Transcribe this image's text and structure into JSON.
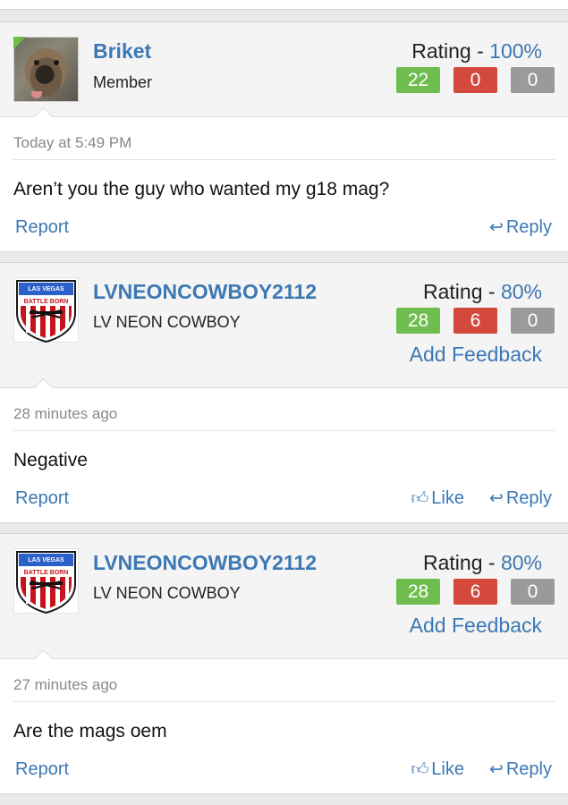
{
  "posts": [
    {
      "username": "Briket",
      "user_title": "Member",
      "rating_label": "Rating - ",
      "rating_value": "100%",
      "feedback_positive": "22",
      "feedback_negative": "0",
      "feedback_neutral": "0",
      "timestamp": "Today at 5:49 PM",
      "message": "Aren’t you the guy who wanted my g18 mag?",
      "report_label": "Report",
      "reply_label": "Reply",
      "online_indicator_color": "#6fbd43"
    },
    {
      "username": "LVNEONCOWBOY2112",
      "user_title": "LV NEON COWBOY",
      "rating_label": "Rating - ",
      "rating_value": "80%",
      "feedback_positive": "28",
      "feedback_negative": "6",
      "feedback_neutral": "0",
      "add_feedback_label": "Add Feedback",
      "timestamp": "28 minutes ago",
      "message": "Negative",
      "report_label": "Report",
      "like_label": "Like",
      "reply_label": "Reply",
      "avatar_text_top": "LAS VEGAS",
      "avatar_text_banner": "BATTLE BORN"
    },
    {
      "username": "LVNEONCOWBOY2112",
      "user_title": "LV NEON COWBOY",
      "rating_label": "Rating - ",
      "rating_value": "80%",
      "feedback_positive": "28",
      "feedback_negative": "6",
      "feedback_neutral": "0",
      "add_feedback_label": "Add Feedback",
      "timestamp": "27 minutes ago",
      "message": "Are the mags oem",
      "report_label": "Report",
      "like_label": "Like",
      "reply_label": "Reply",
      "avatar_text_top": "LAS VEGAS",
      "avatar_text_banner": "BATTLE BORN"
    }
  ],
  "colors": {
    "link_blue": "#3b78b4",
    "positive_green": "#6ebd4e",
    "negative_red": "#d34a3d",
    "neutral_gray": "#9a9a9a"
  },
  "icons": {
    "reply": "reply-arrow-icon",
    "like": "thumbs-up-icon"
  }
}
